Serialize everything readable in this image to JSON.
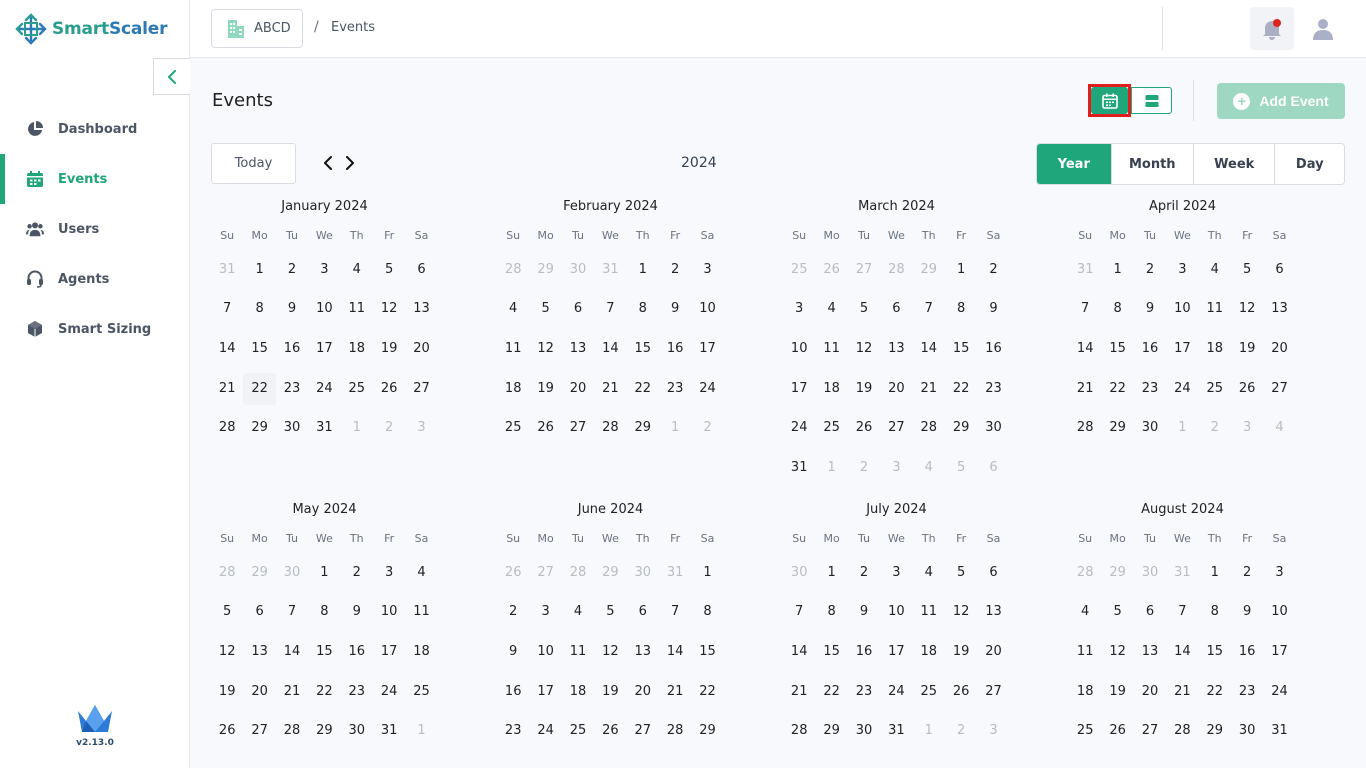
{
  "brand": {
    "name_part1": "Smart",
    "name_part2": "Scaler",
    "version": "v2.13.0"
  },
  "sidebar": {
    "items": [
      {
        "label": "Dashboard",
        "icon": "pie-chart-icon",
        "active": false
      },
      {
        "label": "Events",
        "icon": "calendar-icon",
        "active": true
      },
      {
        "label": "Users",
        "icon": "users-icon",
        "active": false
      },
      {
        "label": "Agents",
        "icon": "headset-icon",
        "active": false
      },
      {
        "label": "Smart Sizing",
        "icon": "cube-icon",
        "active": false
      }
    ]
  },
  "header": {
    "org": "ABCD",
    "separator": "/",
    "page": "Events"
  },
  "main": {
    "title": "Events",
    "add_event_label": "Add Event",
    "today_label": "Today",
    "year": "2024",
    "views": [
      "Year",
      "Month",
      "Week",
      "Day"
    ],
    "active_view": "Year"
  },
  "calendar": {
    "weekdays": [
      "Su",
      "Mo",
      "Tu",
      "We",
      "Th",
      "Fr",
      "Sa"
    ],
    "today": {
      "month": 0,
      "day": 22
    },
    "months": [
      {
        "title": "January 2024",
        "weeks": [
          [
            "31",
            "1",
            "2",
            "3",
            "4",
            "5",
            "6"
          ],
          [
            "7",
            "8",
            "9",
            "10",
            "11",
            "12",
            "13"
          ],
          [
            "14",
            "15",
            "16",
            "17",
            "18",
            "19",
            "20"
          ],
          [
            "21",
            "22",
            "23",
            "24",
            "25",
            "26",
            "27"
          ],
          [
            "28",
            "29",
            "30",
            "31",
            "1",
            "2",
            "3"
          ]
        ],
        "lead": 1,
        "trail": 3
      },
      {
        "title": "February 2024",
        "weeks": [
          [
            "28",
            "29",
            "30",
            "31",
            "1",
            "2",
            "3"
          ],
          [
            "4",
            "5",
            "6",
            "7",
            "8",
            "9",
            "10"
          ],
          [
            "11",
            "12",
            "13",
            "14",
            "15",
            "16",
            "17"
          ],
          [
            "18",
            "19",
            "20",
            "21",
            "22",
            "23",
            "24"
          ],
          [
            "25",
            "26",
            "27",
            "28",
            "29",
            "1",
            "2"
          ]
        ],
        "lead": 4,
        "trail": 2
      },
      {
        "title": "March 2024",
        "weeks": [
          [
            "25",
            "26",
            "27",
            "28",
            "29",
            "1",
            "2"
          ],
          [
            "3",
            "4",
            "5",
            "6",
            "7",
            "8",
            "9"
          ],
          [
            "10",
            "11",
            "12",
            "13",
            "14",
            "15",
            "16"
          ],
          [
            "17",
            "18",
            "19",
            "20",
            "21",
            "22",
            "23"
          ],
          [
            "24",
            "25",
            "26",
            "27",
            "28",
            "29",
            "30"
          ],
          [
            "31",
            "1",
            "2",
            "3",
            "4",
            "5",
            "6"
          ]
        ],
        "lead": 5,
        "trail": 6
      },
      {
        "title": "April 2024",
        "weeks": [
          [
            "31",
            "1",
            "2",
            "3",
            "4",
            "5",
            "6"
          ],
          [
            "7",
            "8",
            "9",
            "10",
            "11",
            "12",
            "13"
          ],
          [
            "14",
            "15",
            "16",
            "17",
            "18",
            "19",
            "20"
          ],
          [
            "21",
            "22",
            "23",
            "24",
            "25",
            "26",
            "27"
          ],
          [
            "28",
            "29",
            "30",
            "1",
            "2",
            "3",
            "4"
          ]
        ],
        "lead": 1,
        "trail": 4
      },
      {
        "title": "May 2024",
        "weeks": [
          [
            "28",
            "29",
            "30",
            "1",
            "2",
            "3",
            "4"
          ],
          [
            "5",
            "6",
            "7",
            "8",
            "9",
            "10",
            "11"
          ],
          [
            "12",
            "13",
            "14",
            "15",
            "16",
            "17",
            "18"
          ],
          [
            "19",
            "20",
            "21",
            "22",
            "23",
            "24",
            "25"
          ],
          [
            "26",
            "27",
            "28",
            "29",
            "30",
            "31",
            "1"
          ]
        ],
        "lead": 3,
        "trail": 1
      },
      {
        "title": "June 2024",
        "weeks": [
          [
            "26",
            "27",
            "28",
            "29",
            "30",
            "31",
            "1"
          ],
          [
            "2",
            "3",
            "4",
            "5",
            "6",
            "7",
            "8"
          ],
          [
            "9",
            "10",
            "11",
            "12",
            "13",
            "14",
            "15"
          ],
          [
            "16",
            "17",
            "18",
            "19",
            "20",
            "21",
            "22"
          ],
          [
            "23",
            "24",
            "25",
            "26",
            "27",
            "28",
            "29"
          ]
        ],
        "lead": 6,
        "trail": 0
      },
      {
        "title": "July 2024",
        "weeks": [
          [
            "30",
            "1",
            "2",
            "3",
            "4",
            "5",
            "6"
          ],
          [
            "7",
            "8",
            "9",
            "10",
            "11",
            "12",
            "13"
          ],
          [
            "14",
            "15",
            "16",
            "17",
            "18",
            "19",
            "20"
          ],
          [
            "21",
            "22",
            "23",
            "24",
            "25",
            "26",
            "27"
          ],
          [
            "28",
            "29",
            "30",
            "31",
            "1",
            "2",
            "3"
          ]
        ],
        "lead": 1,
        "trail": 3
      },
      {
        "title": "August 2024",
        "weeks": [
          [
            "28",
            "29",
            "30",
            "31",
            "1",
            "2",
            "3"
          ],
          [
            "4",
            "5",
            "6",
            "7",
            "8",
            "9",
            "10"
          ],
          [
            "11",
            "12",
            "13",
            "14",
            "15",
            "16",
            "17"
          ],
          [
            "18",
            "19",
            "20",
            "21",
            "22",
            "23",
            "24"
          ],
          [
            "25",
            "26",
            "27",
            "28",
            "29",
            "30",
            "31"
          ]
        ],
        "lead": 4,
        "trail": 0
      }
    ]
  },
  "colors": {
    "accent": "#1fa67a",
    "highlight": "#e01e1e"
  }
}
